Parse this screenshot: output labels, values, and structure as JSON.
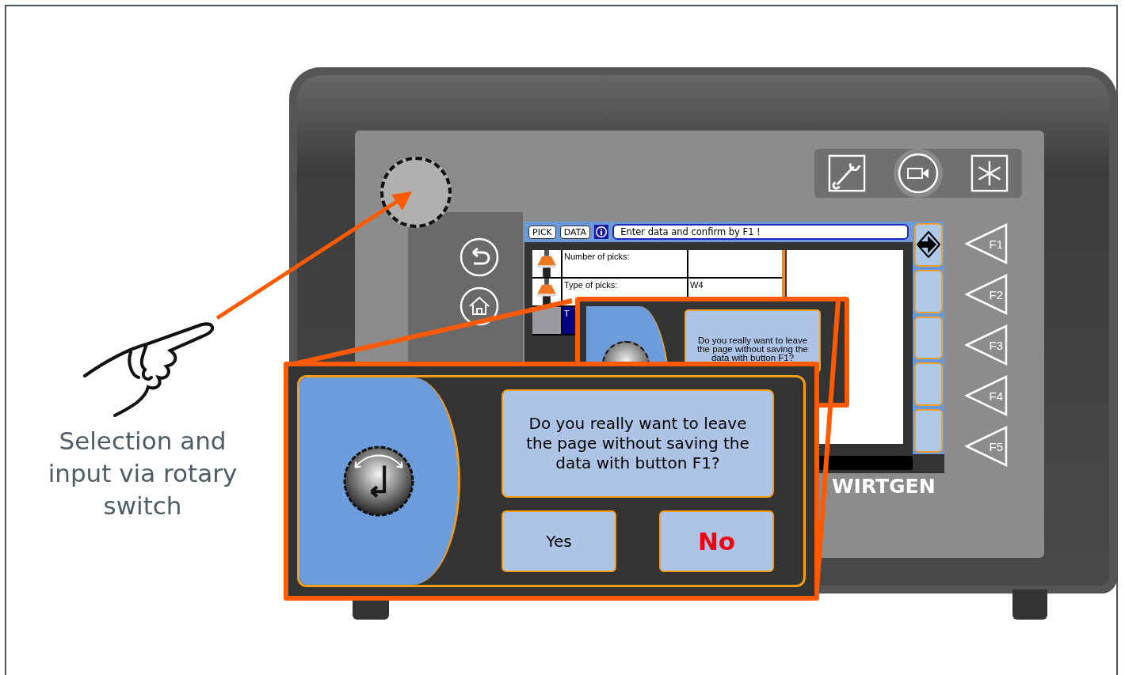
{
  "caption": "Selection and input via rotary switch",
  "device": {
    "brand": "WIRTGEN",
    "function_keys": [
      "F1",
      "F2",
      "F3",
      "F4",
      "F5"
    ],
    "screen": {
      "tabs": [
        {
          "label": "PICK"
        },
        {
          "label": "DATA"
        }
      ],
      "message": "Enter data and confirm by F1 !",
      "rows": [
        {
          "kind": "pick",
          "label": "Number of picks:"
        },
        {
          "kind": "pick",
          "label": "Type of picks:",
          "value": "W4"
        },
        {
          "kind": "photo",
          "label": "T"
        }
      ],
      "softkeys": [
        {
          "kind": "next"
        },
        {
          "kind": "blank"
        },
        {
          "kind": "blank"
        },
        {
          "kind": "blank"
        },
        {
          "kind": "blank"
        }
      ],
      "dialog": {
        "text": "Do you really want to leave the page without saving the data with button F1?"
      }
    }
  },
  "callout": {
    "question": "Do you really want to leave the page without saving the data with button F1?",
    "buttons": [
      {
        "label": "Yes",
        "selected": false
      },
      {
        "label": "No",
        "selected": true
      }
    ]
  }
}
